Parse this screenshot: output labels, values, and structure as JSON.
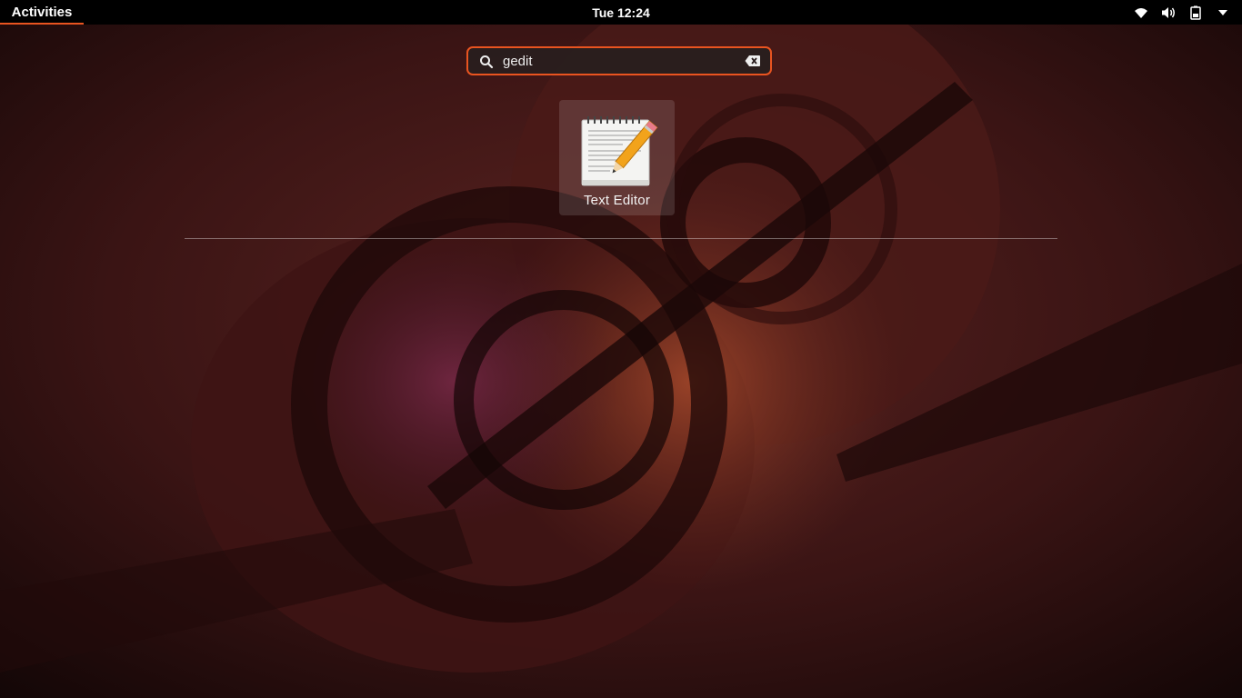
{
  "topbar": {
    "activities_label": "Activities",
    "clock": "Tue 12:24",
    "status_icons": [
      "wifi-icon",
      "volume-icon",
      "battery-icon",
      "dropdown-arrow-icon"
    ]
  },
  "search": {
    "value": "gedit",
    "accent_color": "#e95420"
  },
  "results": [
    {
      "name": "Text Editor",
      "icon": "text-editor-icon"
    }
  ],
  "colors": {
    "accent": "#e95420",
    "topbar_bg": "#000000"
  }
}
